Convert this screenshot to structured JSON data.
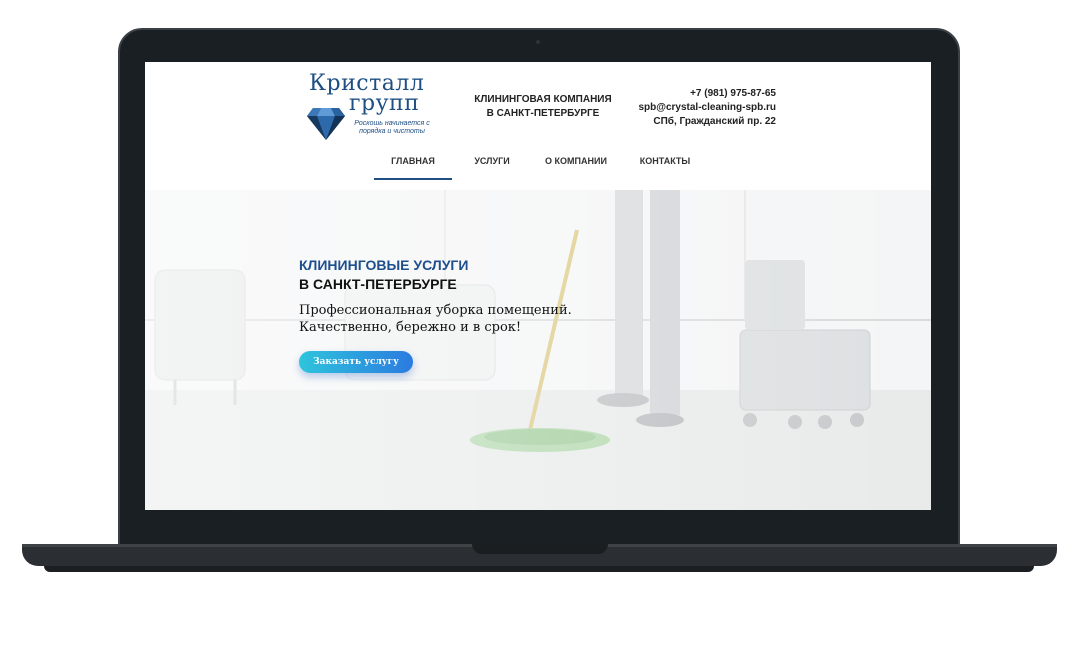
{
  "logo": {
    "word1": "Кристалл",
    "word2": "групп",
    "tagline": "Роскошь начинается с порядка и чистоты"
  },
  "company": {
    "line1": "КЛИНИНГОВАЯ КОМПАНИЯ",
    "line2": "В САНКТ-ПЕТЕРБУРГЕ"
  },
  "contacts": {
    "phone": "+7 (981) 975-87-65",
    "email": "spb@crystal-cleaning-spb.ru",
    "address": "СПб, Гражданский пр. 22"
  },
  "nav": {
    "items": [
      {
        "label": "ГЛАВНАЯ",
        "active": true
      },
      {
        "label": "УСЛУГИ",
        "active": false
      },
      {
        "label": "О КОМПАНИИ",
        "active": false
      },
      {
        "label": "КОНТАКТЫ",
        "active": false
      }
    ]
  },
  "hero": {
    "heading_line1": "КЛИНИНГОВЫЕ УСЛУГИ",
    "heading_line2": "В САНКТ-ПЕТЕРБУРГЕ",
    "subtitle_line1": "Профессиональная уборка помещений.",
    "subtitle_line2": "Качественно, бережно и в срок!",
    "cta_label": "Заказать услугу"
  },
  "colors": {
    "brand": "#1e4e82",
    "heading_accent": "#1e4e8c",
    "cta_start": "#2ec4dc",
    "cta_end": "#2b7be0",
    "laptop": "#1a1f24"
  },
  "icons": [
    "crystal-logo-icon"
  ]
}
